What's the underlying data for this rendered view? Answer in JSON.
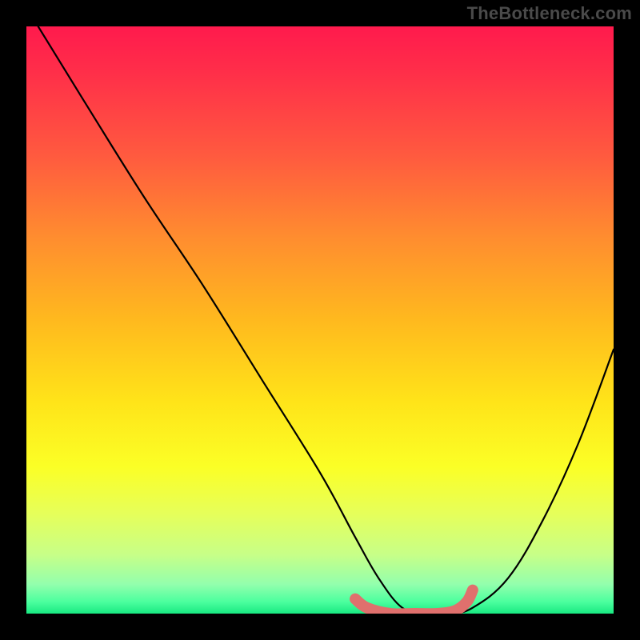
{
  "watermark": "TheBottleneck.com",
  "chart_data": {
    "type": "line",
    "title": "",
    "xlabel": "",
    "ylabel": "",
    "xlim": [
      0,
      100
    ],
    "ylim": [
      0,
      100
    ],
    "grid": false,
    "legend": false,
    "series": [
      {
        "name": "black-curve",
        "color": "#000000",
        "x": [
          2,
          10,
          20,
          30,
          40,
          50,
          56,
          60,
          64,
          68,
          72,
          76,
          82,
          88,
          94,
          100
        ],
        "y": [
          100,
          87,
          71,
          56,
          40,
          24,
          13,
          6,
          1,
          0,
          0,
          1,
          6,
          16,
          29,
          45
        ]
      },
      {
        "name": "red-marker-curve",
        "color": "#e0706d",
        "x": [
          56,
          58,
          62,
          66,
          70,
          73,
          75,
          76
        ],
        "y": [
          2.5,
          1,
          0,
          0,
          0,
          0.5,
          2,
          4
        ]
      }
    ],
    "background_gradient": {
      "orientation": "vertical",
      "stops": [
        {
          "pos": 0.0,
          "color": "#ff1a4d"
        },
        {
          "pos": 0.5,
          "color": "#ffc81e"
        },
        {
          "pos": 0.8,
          "color": "#f4ff3a"
        },
        {
          "pos": 1.0,
          "color": "#18e981"
        }
      ]
    }
  }
}
